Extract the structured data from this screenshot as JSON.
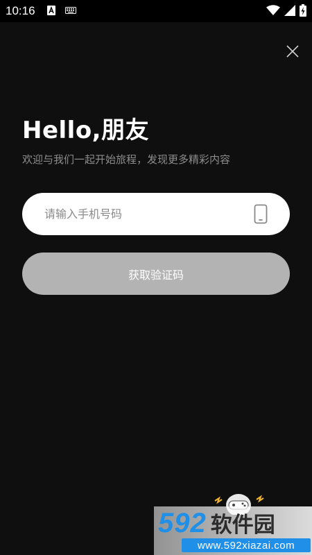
{
  "status_bar": {
    "time": "10:16",
    "icons": [
      "text-input-icon",
      "keyboard-icon",
      "wifi-icon",
      "signal-icon",
      "battery-charging-icon"
    ]
  },
  "login": {
    "headline": "Hello,朋友",
    "subtitle": "欢迎与我们一起开始旅程，发现更多精彩内容",
    "phone_placeholder": "请输入手机号码",
    "phone_value": "",
    "get_code_label": "获取验证码"
  },
  "watermark": {
    "number": "592",
    "name": "软件园",
    "url": "www.592xiazai.com"
  },
  "colors": {
    "background": "#0f0f0f",
    "subtitle_text": "#8d8d8d",
    "input_background": "#ffffff",
    "button_disabled": "#b3b3b3",
    "watermark_blue": "#1f8fe8"
  }
}
